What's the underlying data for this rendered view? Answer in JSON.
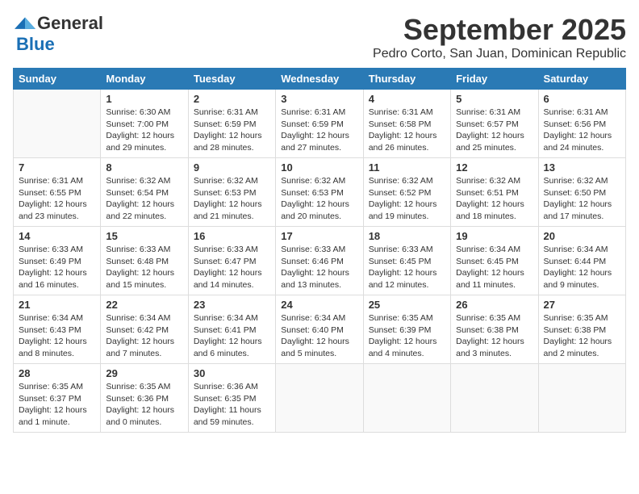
{
  "header": {
    "logo_general": "General",
    "logo_blue": "Blue",
    "month_title": "September 2025",
    "subtitle": "Pedro Corto, San Juan, Dominican Republic"
  },
  "weekdays": [
    "Sunday",
    "Monday",
    "Tuesday",
    "Wednesday",
    "Thursday",
    "Friday",
    "Saturday"
  ],
  "weeks": [
    [
      {
        "day": "",
        "info": ""
      },
      {
        "day": "1",
        "info": "Sunrise: 6:30 AM\nSunset: 7:00 PM\nDaylight: 12 hours\nand 29 minutes."
      },
      {
        "day": "2",
        "info": "Sunrise: 6:31 AM\nSunset: 6:59 PM\nDaylight: 12 hours\nand 28 minutes."
      },
      {
        "day": "3",
        "info": "Sunrise: 6:31 AM\nSunset: 6:59 PM\nDaylight: 12 hours\nand 27 minutes."
      },
      {
        "day": "4",
        "info": "Sunrise: 6:31 AM\nSunset: 6:58 PM\nDaylight: 12 hours\nand 26 minutes."
      },
      {
        "day": "5",
        "info": "Sunrise: 6:31 AM\nSunset: 6:57 PM\nDaylight: 12 hours\nand 25 minutes."
      },
      {
        "day": "6",
        "info": "Sunrise: 6:31 AM\nSunset: 6:56 PM\nDaylight: 12 hours\nand 24 minutes."
      }
    ],
    [
      {
        "day": "7",
        "info": "Sunrise: 6:31 AM\nSunset: 6:55 PM\nDaylight: 12 hours\nand 23 minutes."
      },
      {
        "day": "8",
        "info": "Sunrise: 6:32 AM\nSunset: 6:54 PM\nDaylight: 12 hours\nand 22 minutes."
      },
      {
        "day": "9",
        "info": "Sunrise: 6:32 AM\nSunset: 6:53 PM\nDaylight: 12 hours\nand 21 minutes."
      },
      {
        "day": "10",
        "info": "Sunrise: 6:32 AM\nSunset: 6:53 PM\nDaylight: 12 hours\nand 20 minutes."
      },
      {
        "day": "11",
        "info": "Sunrise: 6:32 AM\nSunset: 6:52 PM\nDaylight: 12 hours\nand 19 minutes."
      },
      {
        "day": "12",
        "info": "Sunrise: 6:32 AM\nSunset: 6:51 PM\nDaylight: 12 hours\nand 18 minutes."
      },
      {
        "day": "13",
        "info": "Sunrise: 6:32 AM\nSunset: 6:50 PM\nDaylight: 12 hours\nand 17 minutes."
      }
    ],
    [
      {
        "day": "14",
        "info": "Sunrise: 6:33 AM\nSunset: 6:49 PM\nDaylight: 12 hours\nand 16 minutes."
      },
      {
        "day": "15",
        "info": "Sunrise: 6:33 AM\nSunset: 6:48 PM\nDaylight: 12 hours\nand 15 minutes."
      },
      {
        "day": "16",
        "info": "Sunrise: 6:33 AM\nSunset: 6:47 PM\nDaylight: 12 hours\nand 14 minutes."
      },
      {
        "day": "17",
        "info": "Sunrise: 6:33 AM\nSunset: 6:46 PM\nDaylight: 12 hours\nand 13 minutes."
      },
      {
        "day": "18",
        "info": "Sunrise: 6:33 AM\nSunset: 6:45 PM\nDaylight: 12 hours\nand 12 minutes."
      },
      {
        "day": "19",
        "info": "Sunrise: 6:34 AM\nSunset: 6:45 PM\nDaylight: 12 hours\nand 11 minutes."
      },
      {
        "day": "20",
        "info": "Sunrise: 6:34 AM\nSunset: 6:44 PM\nDaylight: 12 hours\nand 9 minutes."
      }
    ],
    [
      {
        "day": "21",
        "info": "Sunrise: 6:34 AM\nSunset: 6:43 PM\nDaylight: 12 hours\nand 8 minutes."
      },
      {
        "day": "22",
        "info": "Sunrise: 6:34 AM\nSunset: 6:42 PM\nDaylight: 12 hours\nand 7 minutes."
      },
      {
        "day": "23",
        "info": "Sunrise: 6:34 AM\nSunset: 6:41 PM\nDaylight: 12 hours\nand 6 minutes."
      },
      {
        "day": "24",
        "info": "Sunrise: 6:34 AM\nSunset: 6:40 PM\nDaylight: 12 hours\nand 5 minutes."
      },
      {
        "day": "25",
        "info": "Sunrise: 6:35 AM\nSunset: 6:39 PM\nDaylight: 12 hours\nand 4 minutes."
      },
      {
        "day": "26",
        "info": "Sunrise: 6:35 AM\nSunset: 6:38 PM\nDaylight: 12 hours\nand 3 minutes."
      },
      {
        "day": "27",
        "info": "Sunrise: 6:35 AM\nSunset: 6:38 PM\nDaylight: 12 hours\nand 2 minutes."
      }
    ],
    [
      {
        "day": "28",
        "info": "Sunrise: 6:35 AM\nSunset: 6:37 PM\nDaylight: 12 hours\nand 1 minute."
      },
      {
        "day": "29",
        "info": "Sunrise: 6:35 AM\nSunset: 6:36 PM\nDaylight: 12 hours\nand 0 minutes."
      },
      {
        "day": "30",
        "info": "Sunrise: 6:36 AM\nSunset: 6:35 PM\nDaylight: 11 hours\nand 59 minutes."
      },
      {
        "day": "",
        "info": ""
      },
      {
        "day": "",
        "info": ""
      },
      {
        "day": "",
        "info": ""
      },
      {
        "day": "",
        "info": ""
      }
    ]
  ]
}
